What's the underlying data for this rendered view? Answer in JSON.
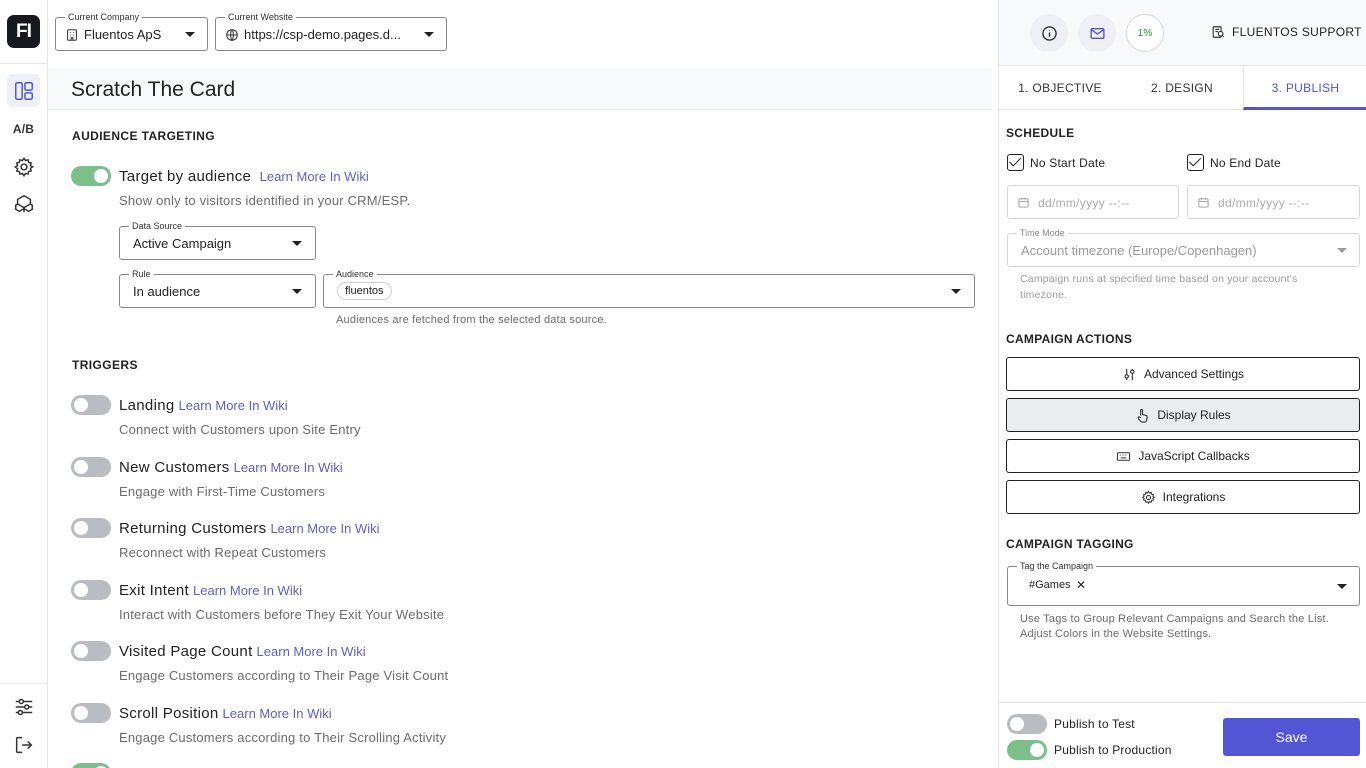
{
  "nav": {
    "logo": "FI",
    "ab_label": "A/B",
    "items": [
      "campaigns-icon",
      "ab-test",
      "settings-icon",
      "integrations-icon",
      "filters-icon",
      "logout-icon"
    ]
  },
  "topbar": {
    "company_label": "Current Company",
    "company_value": "Fluentos ApS",
    "website_label": "Current Website",
    "website_value": "https://csp-demo.pages.d..."
  },
  "main": {
    "title": "Scratch The Card",
    "audience_heading": "AUDIENCE TARGETING",
    "audience_toggle": {
      "title": "Target by audience",
      "wiki": "Learn More In Wiki",
      "desc": "Show only to visitors identified in your CRM/ESP.",
      "on": true
    },
    "data_source": {
      "label": "Data Source",
      "value": "Active Campaign"
    },
    "rule": {
      "label": "Rule",
      "value": "In audience"
    },
    "audience": {
      "label": "Audience",
      "chip": "fluentos"
    },
    "audience_help": "Audiences are fetched from the selected data source.",
    "triggers_heading": "TRIGGERS",
    "triggers": [
      {
        "title": "Landing",
        "wiki": "Learn More In Wiki",
        "desc": "Connect with Customers upon Site Entry",
        "on": false
      },
      {
        "title": "New Customers",
        "wiki": "Learn More In Wiki",
        "desc": "Engage with First-Time Customers",
        "on": false
      },
      {
        "title": "Returning Customers",
        "wiki": "Learn More In Wiki",
        "desc": "Reconnect with Repeat Customers",
        "on": false
      },
      {
        "title": "Exit Intent",
        "wiki": "Learn More In Wiki",
        "desc": "Interact with Customers before They Exit Your Website",
        "on": false
      },
      {
        "title": "Visited Page Count",
        "wiki": "Learn More In Wiki",
        "desc": "Engage Customers according to Their Page Visit Count",
        "on": false
      },
      {
        "title": "Scroll Position",
        "wiki": "Learn More In Wiki",
        "desc": "Engage Customers according to Their Scrolling Activity",
        "on": false
      }
    ]
  },
  "right": {
    "progress": "1%",
    "support": "FLUENTOS SUPPORT",
    "tabs": [
      "1. OBJECTIVE",
      "2. DESIGN",
      "3. PUBLISH"
    ],
    "schedule_heading": "SCHEDULE",
    "no_start": "No Start Date",
    "no_end": "No End Date",
    "date_placeholder": "dd/mm/yyyy --:--",
    "time_mode_label": "Time Mode",
    "time_mode_value": "Account timezone (Europe/Copenhagen)",
    "time_help_1": "Campaign runs at specified time based on your account's",
    "time_help_2": "timezone.",
    "actions_heading": "CAMPAIGN ACTIONS",
    "actions": [
      "Advanced Settings",
      "Display Rules",
      "JavaScript Callbacks",
      "Integrations"
    ],
    "tagging_heading": "CAMPAIGN TAGGING",
    "tag_label": "Tag the Campaign",
    "tag_value": "#Games",
    "tag_help_1": "Use Tags to Group Relevant Campaigns and Search the List.",
    "tag_help_2": "Adjust Colors in the Website Settings.",
    "publish_test": "Publish to Test",
    "publish_prod": "Publish to Production",
    "publish_test_on": false,
    "publish_prod_on": true,
    "save": "Save"
  },
  "colors": {
    "accent": "#5256d4",
    "toggle_on": "#7cbf8a",
    "link": "#5f5fbf"
  }
}
